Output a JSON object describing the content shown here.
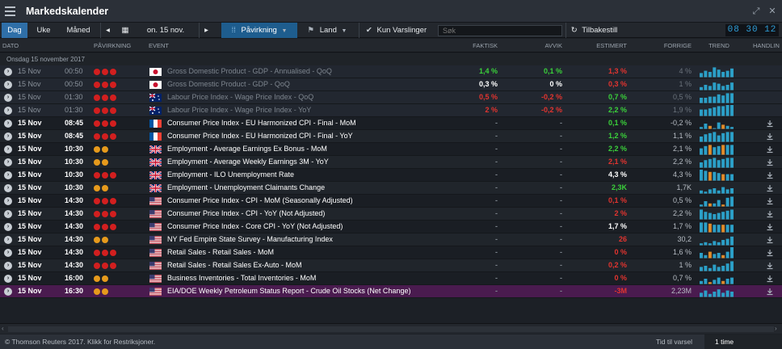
{
  "window": {
    "title": "Markedskalender"
  },
  "toolbar": {
    "day": "Dag",
    "week": "Uke",
    "month": "Måned",
    "date": "on. 15 nov.",
    "impact": "Påvirkning",
    "country": "Land",
    "alerts_only": "Kun Varslinger",
    "search_placeholder": "Søk",
    "reset": "Tilbakestill",
    "clock": "08 30 12"
  },
  "columns": {
    "date": "DATO",
    "impact": "PÅVIRKNING",
    "event": "EVENT",
    "actual": "FAKTISK",
    "deviation": "AVVIK",
    "estimate": "ESTIMERT",
    "previous": "FORRIGE",
    "trend": "TREND",
    "action": "HANDLIN"
  },
  "group_label": "Onsdag 15 november 2017",
  "events": [
    {
      "date": "15 Nov",
      "time": "00:50",
      "impact": 3,
      "country": "JP",
      "event": "Gross Domestic Product - GDP - Annualised - QoQ",
      "actual": "1,4 %",
      "actual_color": "green",
      "deviation": "0,1 %",
      "deviation_color": "green",
      "estimate": "1,3 %",
      "estimate_color": "red",
      "previous": "4 %",
      "past": true,
      "trend": [
        0.4,
        0.6,
        0.5,
        0.9,
        0.7,
        0.5,
        0.6,
        0.8
      ]
    },
    {
      "date": "15 Nov",
      "time": "00:50",
      "impact": 3,
      "country": "JP",
      "event": "Gross Domestic Product - GDP - QoQ",
      "actual": "0,3 %",
      "actual_color": "white",
      "deviation": "0 %",
      "deviation_color": "white",
      "estimate": "0,3 %",
      "estimate_color": "red",
      "previous": "1 %",
      "past": true,
      "trend": [
        0.3,
        0.5,
        0.4,
        0.7,
        0.6,
        0.4,
        0.5,
        0.7
      ]
    },
    {
      "date": "15 Nov",
      "time": "01:30",
      "impact": 3,
      "country": "AU",
      "event": "Labour Price Index - Wage Price Index - QoQ",
      "actual": "0,5 %",
      "actual_color": "red",
      "deviation": "-0,2 %",
      "deviation_color": "red",
      "estimate": "0,7 %",
      "estimate_color": "green",
      "previous": "0,5 %",
      "past": true,
      "trend": [
        0.5,
        0.5,
        0.6,
        0.6,
        0.8,
        0.7,
        0.9,
        0.9
      ]
    },
    {
      "date": "15 Nov",
      "time": "01:30",
      "impact": 3,
      "country": "AU",
      "event": "Labour Price Index - Wage Price Index - YoY",
      "actual": "2 %",
      "actual_color": "red",
      "deviation": "-0,2 %",
      "deviation_color": "red",
      "estimate": "2,2 %",
      "estimate_color": "green",
      "previous": "1,9 %",
      "past": true,
      "trend": [
        0.6,
        0.6,
        0.7,
        0.8,
        0.9,
        0.9,
        1,
        1
      ]
    },
    {
      "date": "15 Nov",
      "time": "08:45",
      "impact": 3,
      "country": "FR",
      "event": "Consumer Price Index - EU Harmonized CPI - Final - MoM",
      "actual": "-",
      "actual_color": "dim",
      "deviation": "-",
      "deviation_color": "dim",
      "estimate": "0,1 %",
      "estimate_color": "green",
      "previous": "-0,2 %",
      "past": false,
      "trend": [
        0.2,
        0.5,
        0.3,
        0.1,
        0.6,
        0.4,
        0.3,
        0.2
      ]
    },
    {
      "date": "15 Nov",
      "time": "08:45",
      "impact": 3,
      "country": "FR",
      "event": "Consumer Price Index - EU Harmonized CPI - Final - YoY",
      "actual": "-",
      "actual_color": "dim",
      "deviation": "-",
      "deviation_color": "dim",
      "estimate": "1,2 %",
      "estimate_color": "green",
      "previous": "1,1 %",
      "past": false,
      "trend": [
        0.5,
        0.7,
        0.8,
        0.9,
        0.6,
        0.8,
        0.9,
        0.9
      ]
    },
    {
      "date": "15 Nov",
      "time": "10:30",
      "impact": 2,
      "country": "GB",
      "event": "Employment - Average Earnings Ex Bonus - MoM",
      "actual": "-",
      "actual_color": "dim",
      "deviation": "-",
      "deviation_color": "dim",
      "estimate": "2,2 %",
      "estimate_color": "green",
      "previous": "2,1 %",
      "past": false,
      "trend": [
        0.6,
        0.8,
        0.9,
        0.7,
        0.8,
        0.9,
        0.9,
        0.9
      ]
    },
    {
      "date": "15 Nov",
      "time": "10:30",
      "impact": 2,
      "country": "GB",
      "event": "Employment - Average Weekly Earnings 3M - YoY",
      "actual": "-",
      "actual_color": "dim",
      "deviation": "-",
      "deviation_color": "dim",
      "estimate": "2,1 %",
      "estimate_color": "red",
      "previous": "2,2 %",
      "past": false,
      "trend": [
        0.5,
        0.7,
        0.8,
        0.9,
        0.7,
        0.8,
        0.9,
        0.9
      ]
    },
    {
      "date": "15 Nov",
      "time": "10:30",
      "impact": 3,
      "country": "GB",
      "event": "Employment - ILO Unemployment Rate",
      "actual": "-",
      "actual_color": "dim",
      "deviation": "-",
      "deviation_color": "dim",
      "estimate": "4,3 %",
      "estimate_color": "white",
      "previous": "4,3 %",
      "past": false,
      "trend": [
        1,
        0.9,
        0.8,
        0.8,
        0.7,
        0.6,
        0.6,
        0.6
      ]
    },
    {
      "date": "15 Nov",
      "time": "10:30",
      "impact": 2,
      "country": "GB",
      "event": "Employment - Unemployment Claimants Change",
      "actual": "-",
      "actual_color": "dim",
      "deviation": "-",
      "deviation_color": "dim",
      "estimate": "2,3K",
      "estimate_color": "green",
      "previous": "1,7K",
      "past": false,
      "trend": [
        0.3,
        0.2,
        0.4,
        0.5,
        0.3,
        0.6,
        0.4,
        0.5
      ]
    },
    {
      "date": "15 Nov",
      "time": "14:30",
      "impact": 3,
      "country": "US",
      "event": "Consumer Price Index - CPI - MoM (Seasonally Adjusted)",
      "actual": "-",
      "actual_color": "dim",
      "deviation": "-",
      "deviation_color": "dim",
      "estimate": "0,1 %",
      "estimate_color": "red",
      "previous": "0,5 %",
      "past": false,
      "trend": [
        0.2,
        0.5,
        0.3,
        0.3,
        0.6,
        0.2,
        0.8,
        0.9
      ]
    },
    {
      "date": "15 Nov",
      "time": "14:30",
      "impact": 3,
      "country": "US",
      "event": "Consumer Price Index - CPI - YoY (Not Adjusted)",
      "actual": "-",
      "actual_color": "dim",
      "deviation": "-",
      "deviation_color": "dim",
      "estimate": "2 %",
      "estimate_color": "red",
      "previous": "2,2 %",
      "past": false,
      "trend": [
        0.9,
        0.7,
        0.6,
        0.5,
        0.6,
        0.7,
        0.8,
        0.9
      ]
    },
    {
      "date": "15 Nov",
      "time": "14:30",
      "impact": 3,
      "country": "US",
      "event": "Consumer Price Index - Core CPI - YoY (Not Adjusted)",
      "actual": "-",
      "actual_color": "dim",
      "deviation": "-",
      "deviation_color": "dim",
      "estimate": "1,7 %",
      "estimate_color": "white",
      "previous": "1,7 %",
      "past": false,
      "trend": [
        0.9,
        0.9,
        0.8,
        0.7,
        0.7,
        0.7,
        0.7,
        0.7
      ]
    },
    {
      "date": "15 Nov",
      "time": "14:30",
      "impact": 2,
      "country": "US",
      "event": "NY Fed Empire State Survey - Manufacturing Index",
      "actual": "-",
      "actual_color": "dim",
      "deviation": "-",
      "deviation_color": "dim",
      "estimate": "26",
      "estimate_color": "red",
      "previous": "30,2",
      "past": false,
      "trend": [
        0.2,
        0.3,
        0.2,
        0.4,
        0.3,
        0.5,
        0.6,
        0.8
      ]
    },
    {
      "date": "15 Nov",
      "time": "14:30",
      "impact": 3,
      "country": "US",
      "event": "Retail Sales - Retail Sales - MoM",
      "actual": "-",
      "actual_color": "dim",
      "deviation": "-",
      "deviation_color": "dim",
      "estimate": "0 %",
      "estimate_color": "red",
      "previous": "1,6 %",
      "past": false,
      "trend": [
        0.5,
        0.3,
        0.6,
        0.4,
        0.5,
        0.3,
        0.6,
        1
      ]
    },
    {
      "date": "15 Nov",
      "time": "14:30",
      "impact": 3,
      "country": "US",
      "event": "Retail Sales - Retail Sales Ex-Auto - MoM",
      "actual": "-",
      "actual_color": "dim",
      "deviation": "-",
      "deviation_color": "dim",
      "estimate": "0,2 %",
      "estimate_color": "red",
      "previous": "1 %",
      "past": false,
      "trend": [
        0.4,
        0.5,
        0.3,
        0.6,
        0.4,
        0.5,
        0.7,
        0.9
      ]
    },
    {
      "date": "15 Nov",
      "time": "16:00",
      "impact": 2,
      "country": "US",
      "event": "Business Inventories - Total Inventories - MoM",
      "actual": "-",
      "actual_color": "dim",
      "deviation": "-",
      "deviation_color": "dim",
      "estimate": "0 %",
      "estimate_color": "red",
      "previous": "0,7 %",
      "past": false,
      "trend": [
        0.3,
        0.5,
        0.2,
        0.4,
        0.6,
        0.3,
        0.5,
        0.6
      ]
    },
    {
      "date": "15 Nov",
      "time": "16:30",
      "impact": 2,
      "country": "US",
      "event": "EIA/DOE Weekly Petroleum Status Report - Crude Oil Stocks (Net Change)",
      "actual": "-",
      "actual_color": "dim",
      "deviation": "-",
      "deviation_color": "dim",
      "estimate": "-3M",
      "estimate_color": "red",
      "previous": "2,23M",
      "past": false,
      "highlight": true,
      "trend": [
        0.4,
        0.6,
        0.3,
        0.5,
        0.7,
        0.4,
        0.6,
        0.5
      ]
    }
  ],
  "status": {
    "copyright": "© Thomson Reuters 2017. Klikk for Restriksjoner.",
    "time_to_alert_label": "Tid til varsel",
    "time_to_alert_value": "1 time"
  },
  "colors": {
    "accent": "#2f6fa8",
    "impact_high": "#d21f1f",
    "impact_medium": "#e69a1c",
    "positive": "#3ad13a",
    "negative": "#e3342f",
    "trend_bar": "#2b9fc7",
    "trend_neg_bar": "#e08a2a",
    "highlight_row": "#4a1b4f"
  }
}
